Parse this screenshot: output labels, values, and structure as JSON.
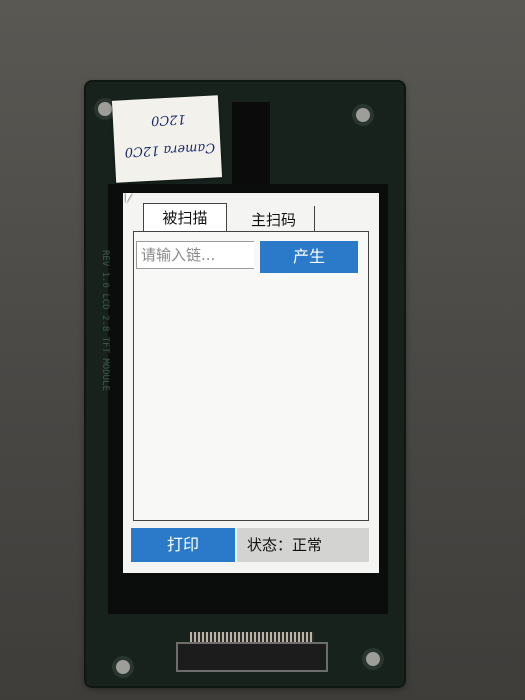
{
  "sticker": {
    "line1": "Camera 12C0",
    "line2": "12C0"
  },
  "side_label": "REV 1.0 LCD 2.8 TFT MODULE",
  "tabs": [
    {
      "label": "被扫描"
    },
    {
      "label": "主扫码"
    }
  ],
  "input": {
    "placeholder": "请输入链...",
    "value": ""
  },
  "generate_button": {
    "label": "产生"
  },
  "print_button": {
    "label": "打印"
  },
  "status": {
    "text": "状态：正常"
  },
  "colors": {
    "accent": "#2a7ac9",
    "status_bg": "#d3d4d2",
    "screen_bg": "#f4f5f3"
  }
}
